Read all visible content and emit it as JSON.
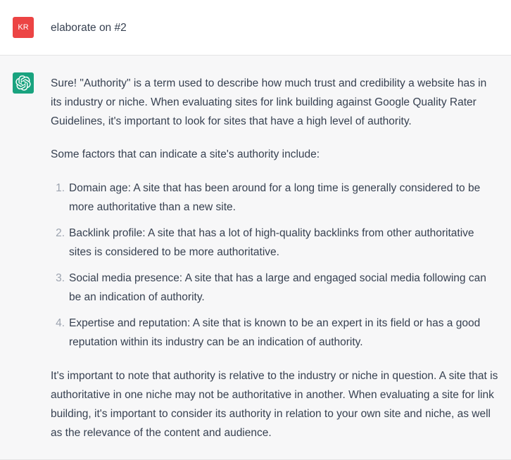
{
  "user": {
    "initials": "KR",
    "message": "elaborate on #2"
  },
  "assistant": {
    "intro": "Sure! \"Authority\" is a term used to describe how much trust and credibility a website has in its industry or niche. When evaluating sites for link building against Google Quality Rater Guidelines, it's important to look for sites that have a high level of authority.",
    "lead": "Some factors that can indicate a site's authority include:",
    "items": [
      "Domain age: A site that has been around for a long time is generally considered to be more authoritative than a new site.",
      "Backlink profile: A site that has a lot of high-quality backlinks from other authoritative sites is considered to be more authoritative.",
      "Social media presence: A site that has a large and engaged social media following can be an indication of authority.",
      "Expertise and reputation: A site that is known to be an expert in its field or has a good reputation within its industry can be an indication of authority."
    ],
    "outro": "It's important to note that authority is relative to the industry or niche in question. A site that is authoritative in one niche may not be authoritative in another. When evaluating a site for link building, it's important to consider its authority in relation to your own site and niche, as well as the relevance of the content and audience."
  }
}
